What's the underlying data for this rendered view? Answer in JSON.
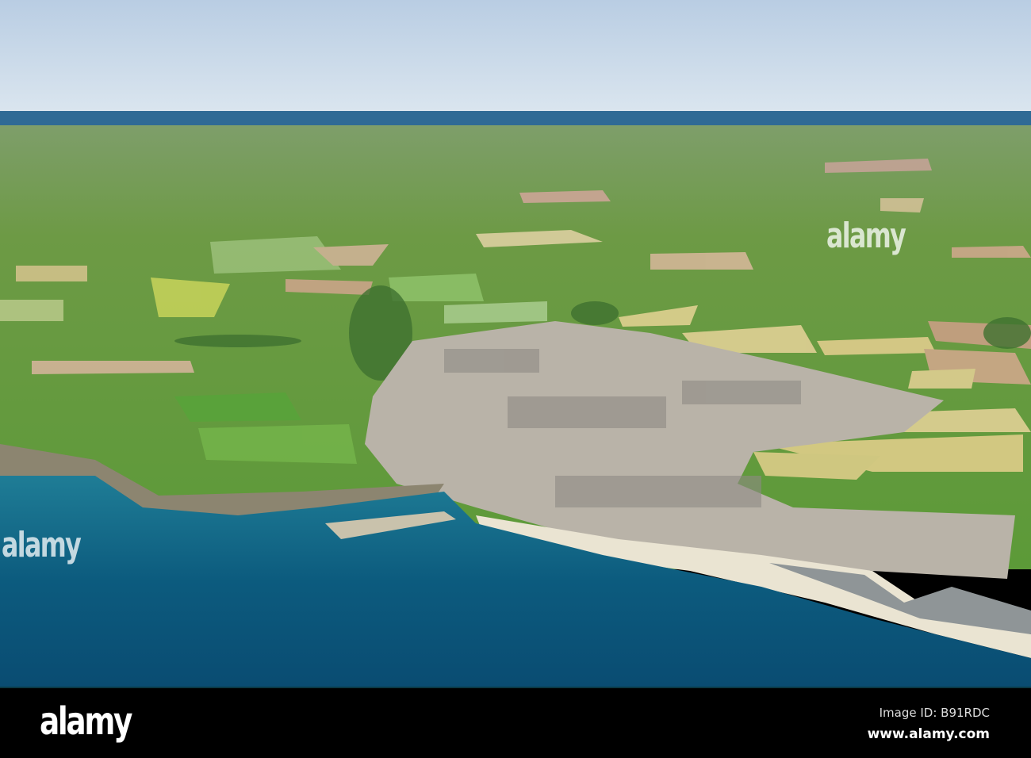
{
  "watermark": {
    "logo": "alamy"
  },
  "footer": {
    "logo": "alamy",
    "image_id": "Image ID: B91RDC",
    "url": "www.alamy.com"
  },
  "colors": {
    "sky": "#c9d9ea",
    "sea": "#0e5a7e",
    "fields": "#6fa83f",
    "footer": "#000000"
  }
}
